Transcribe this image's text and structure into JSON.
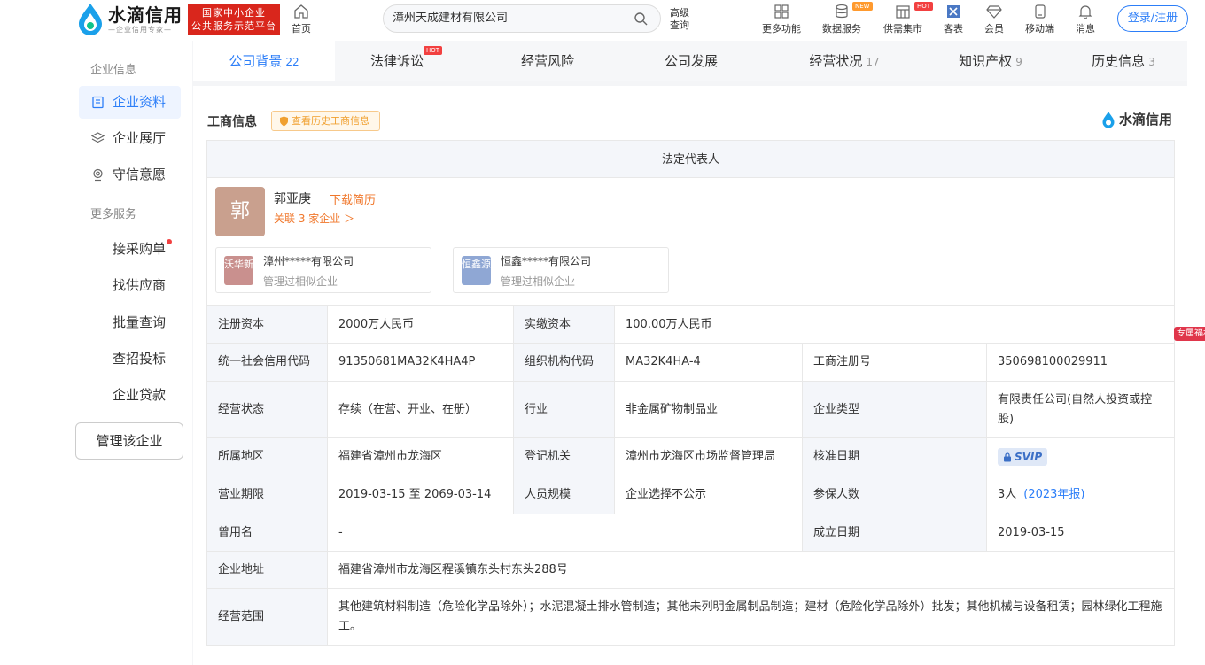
{
  "header": {
    "logo_title": "水滴信用",
    "logo_slogan": "—企业信用专家—",
    "logo_badge_line1": "国家中小企业",
    "logo_badge_line2": "公共服务示范平台",
    "home_label": "首页",
    "search_value": "漳州天成建材有限公司",
    "advanced_search_label": "高级查询",
    "tools": [
      {
        "label": "更多功能",
        "icon": "grid-icon"
      },
      {
        "label": "数据服务",
        "icon": "database-icon",
        "tag": "NEW"
      },
      {
        "label": "供需集市",
        "icon": "market-icon",
        "tag": "HOT"
      },
      {
        "label": "客表",
        "icon": "excel-icon"
      },
      {
        "label": "会员",
        "icon": "diamond-icon"
      },
      {
        "label": "移动端",
        "icon": "mobile-icon"
      },
      {
        "label": "消息",
        "icon": "bell-icon"
      }
    ],
    "login_label": "登录/注册"
  },
  "sidebar": {
    "group1": "企业信息",
    "items": [
      {
        "label": "企业资料",
        "icon": "document-icon",
        "active": true
      },
      {
        "label": "企业展厅",
        "icon": "layers-icon"
      },
      {
        "label": "守信意愿",
        "icon": "seal-icon"
      }
    ],
    "group2": "更多服务",
    "services": [
      "接采购单",
      "找供应商",
      "批量查询",
      "查招投标",
      "企业贷款"
    ],
    "manage_label": "管理该企业"
  },
  "tabs": [
    {
      "label": "公司背景",
      "count": "22",
      "active": true
    },
    {
      "label": "法律诉讼",
      "count": "",
      "hot": "HOT"
    },
    {
      "label": "经营风险",
      "count": ""
    },
    {
      "label": "公司发展",
      "count": ""
    },
    {
      "label": "经营状况",
      "count": "17"
    },
    {
      "label": "知识产权",
      "count": "9"
    },
    {
      "label": "历史信息",
      "count": "3"
    }
  ],
  "section": {
    "title": "工商信息",
    "history_link": "查看历史工商信息",
    "brand": "水滴信用"
  },
  "legal_rep": {
    "header": "法定代表人",
    "avatar_char": "郭",
    "name": "郭亚庚",
    "download": "下载简历",
    "associated": "关联 3 家企业 ＞",
    "companies": [
      {
        "logo": "沃华新",
        "name": "漳州*****有限公司",
        "sub": "管理过相似企业",
        "color": "#c9908e"
      },
      {
        "logo": "恒鑫源",
        "name": "恒鑫*****有限公司",
        "sub": "管理过相似企业",
        "color": "#8fa7d4"
      }
    ]
  },
  "info": {
    "reg_capital_label": "注册资本",
    "reg_capital": "2000万人民币",
    "paid_capital_label": "实缴资本",
    "paid_capital": "100.00万人民币",
    "credit_code_label": "统一社会信用代码",
    "credit_code": "91350681MA32K4HA4P",
    "org_code_label": "组织机构代码",
    "org_code": "MA32K4HA-4",
    "reg_no_label": "工商注册号",
    "reg_no": "350698100029911",
    "status_label": "经营状态",
    "status": "存续（在营、开业、在册）",
    "industry_label": "行业",
    "industry": "非金属矿物制品业",
    "type_label": "企业类型",
    "type": "有限责任公司(自然人投资或控股)",
    "region_label": "所属地区",
    "region": "福建省漳州市龙海区",
    "authority_label": "登记机关",
    "authority": "漳州市龙海区市场监督管理局",
    "approve_label": "核准日期",
    "approve": "SVIP",
    "term_label": "营业期限",
    "term": "2019-03-15 至 2069-03-14",
    "staff_label": "人员规模",
    "staff": "企业选择不公示",
    "insured_label": "参保人数",
    "insured": "3人",
    "insured_year": "(2023年报)",
    "former_label": "曾用名",
    "former": "-",
    "founded_label": "成立日期",
    "founded": "2019-03-15",
    "address_label": "企业地址",
    "address": "福建省漳州市龙海区程溪镇东头村东头288号",
    "scope_label": "经营范围",
    "scope": "其他建筑材料制造（危险化学品除外）；水泥混凝土排水管制造；其他未列明金属制品制造；建材（危险化学品除外）批发；其他机械与设备租赁；园林绿化工程施工。"
  },
  "side_tag": "专属福利"
}
